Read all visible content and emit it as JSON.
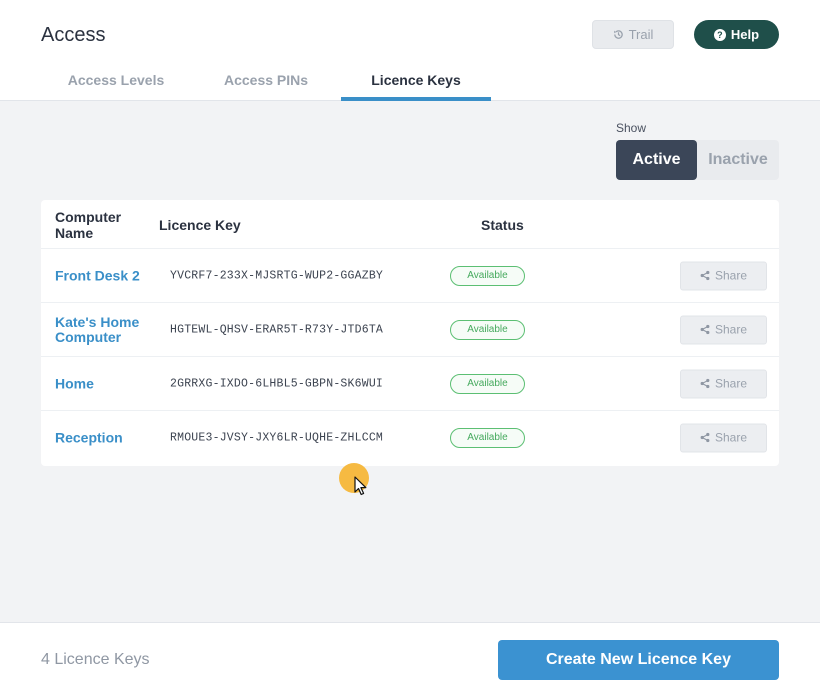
{
  "header": {
    "title": "Access",
    "trail_label": "Trail",
    "help_label": "Help"
  },
  "tabs": [
    {
      "label": "Access Levels",
      "active": false
    },
    {
      "label": "Access PINs",
      "active": false
    },
    {
      "label": "Licence Keys",
      "active": true
    }
  ],
  "filter": {
    "label": "Show",
    "options": [
      "Active",
      "Inactive"
    ],
    "selected": "Active"
  },
  "table": {
    "columns": [
      "Computer Name",
      "Licence Key",
      "Status"
    ],
    "rows": [
      {
        "name": "Front Desk 2",
        "key": "YVCRF7-233X-MJSRTG-WUP2-GGAZBY",
        "status": "Available",
        "action": "Share"
      },
      {
        "name": "Kate's Home Computer",
        "key": "HGTEWL-QHSV-ERAR5T-R73Y-JTD6TA",
        "status": "Available",
        "action": "Share"
      },
      {
        "name": "Home",
        "key": "2GRRXG-IXDO-6LHBL5-GBPN-SK6WUI",
        "status": "Available",
        "action": "Share"
      },
      {
        "name": "Reception",
        "key": "RMOUE3-JVSY-JXY6LR-UQHE-ZHLCCM",
        "status": "Available",
        "action": "Share"
      }
    ]
  },
  "footer": {
    "count_label": "4 Licence Keys",
    "create_label": "Create New Licence Key"
  },
  "colors": {
    "accent": "#3b92d1",
    "help_button": "#1f4f4a",
    "status_available": "#5cbf73",
    "toggle_active": "#3b4658"
  },
  "icons": {
    "trail": "history-icon",
    "help": "question-circle-icon",
    "share": "share-icon"
  }
}
